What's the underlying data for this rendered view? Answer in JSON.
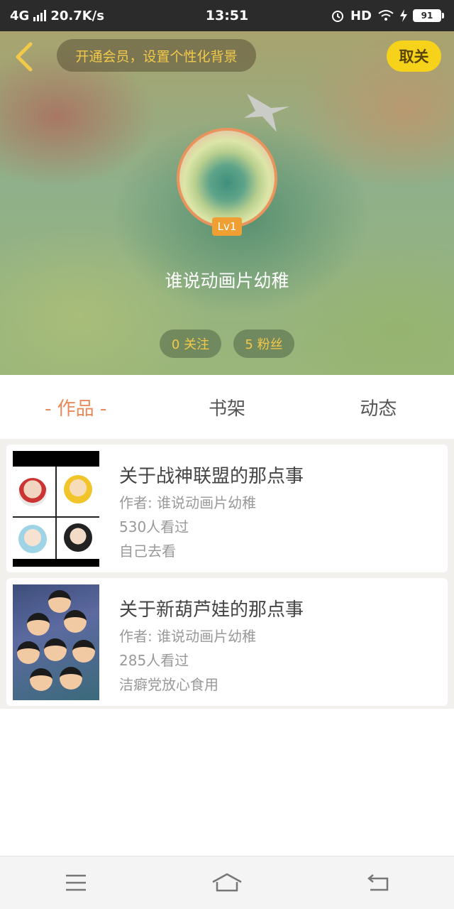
{
  "status_bar": {
    "network": "4G",
    "speed": "20.7K/s",
    "time": "13:51",
    "hd": "HD",
    "battery": "91"
  },
  "header": {
    "vip_promo": "开通会员，设置个性化背景",
    "unfollow_label": "取关",
    "level": "Lv1",
    "username": "谁说动画片幼稚",
    "following": "0 关注",
    "fans": "5 粉丝"
  },
  "tabs": [
    {
      "label": "- 作品 -",
      "active": true
    },
    {
      "label": "书架",
      "active": false
    },
    {
      "label": "动态",
      "active": false
    }
  ],
  "works": [
    {
      "title": "关于战神联盟的那点事",
      "author": "作者: 谁说动画片幼稚",
      "views": "530人看过",
      "description": "自己去看"
    },
    {
      "title": "关于新葫芦娃的那点事",
      "author": "作者: 谁说动画片幼稚",
      "views": "285人看过",
      "description": "洁癖党放心食用"
    }
  ],
  "nav": {
    "menu_icon": "menu-icon",
    "home_icon": "home-icon",
    "back_icon": "back-icon"
  },
  "colors": {
    "accent": "#e8895a",
    "vip_text": "#f3c94a",
    "unfollow_bg": "#f7d21a"
  }
}
